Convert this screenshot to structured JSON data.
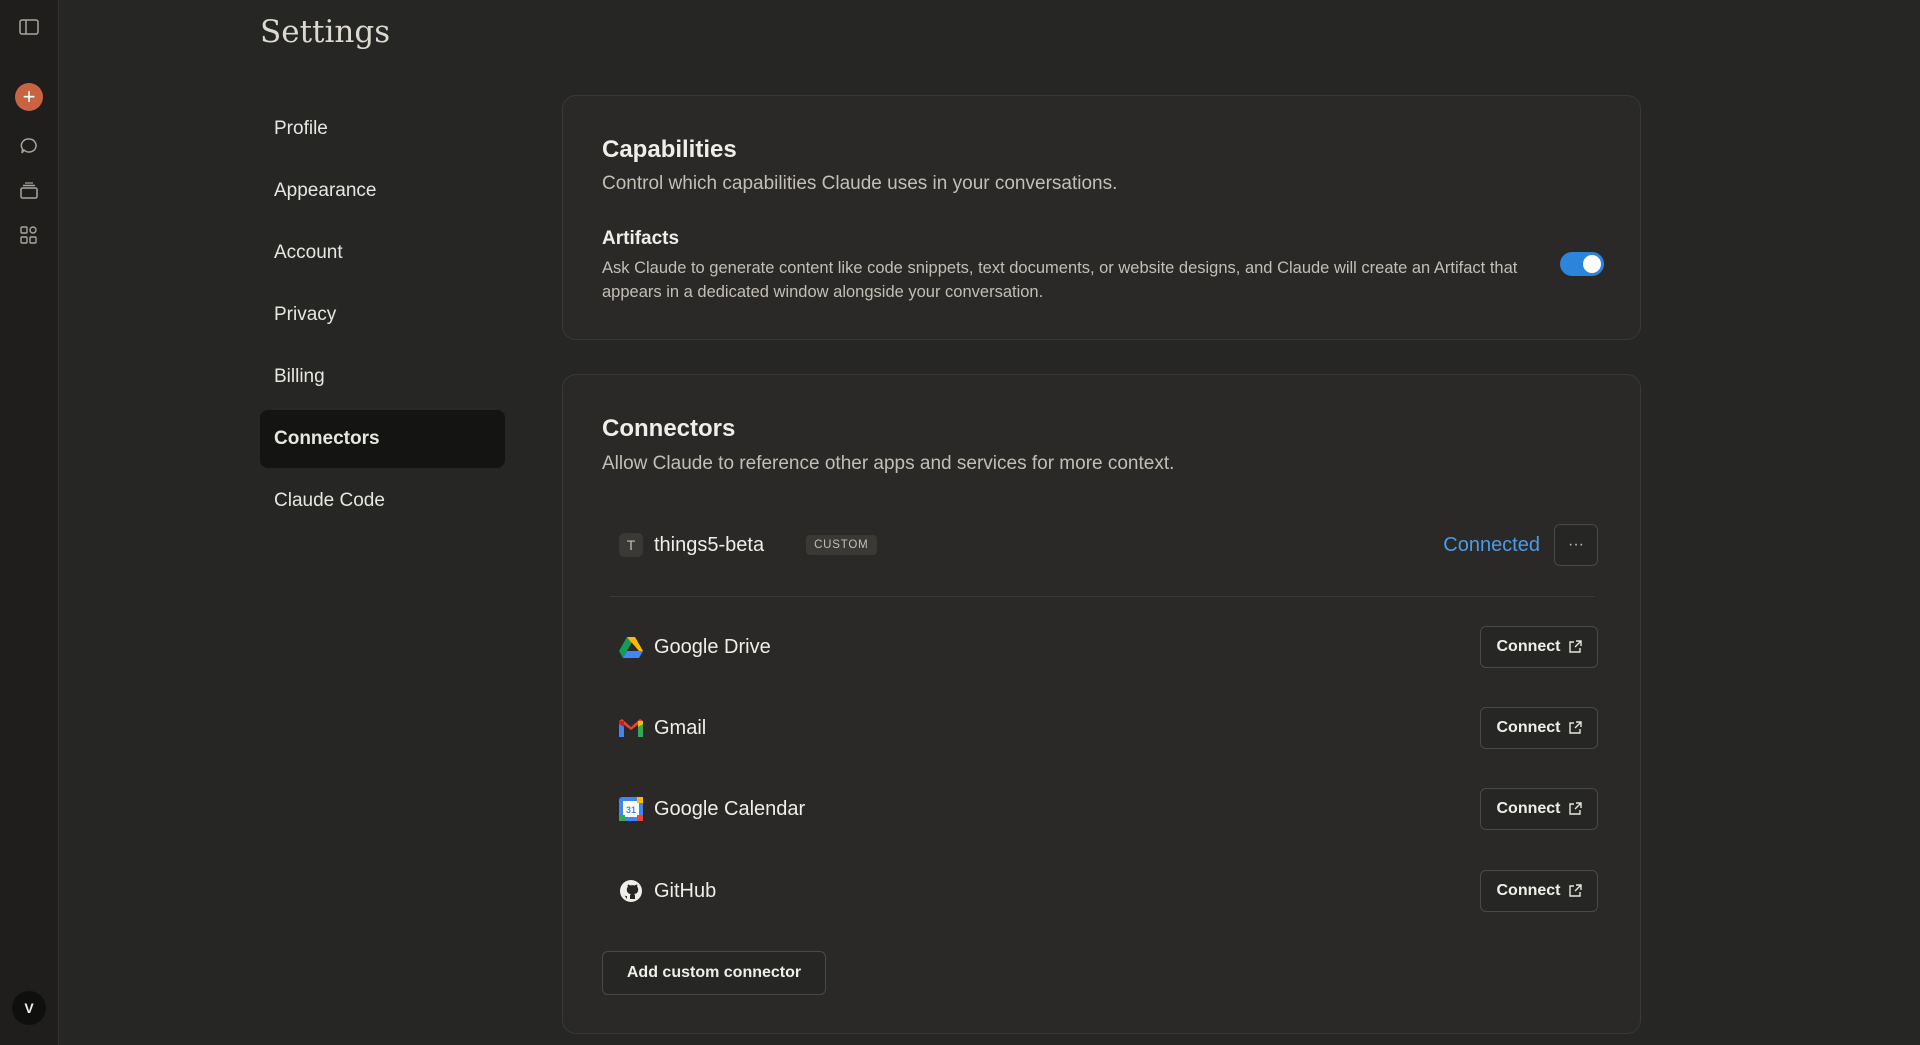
{
  "rail": {
    "icons": [
      "sidebar-toggle-icon",
      "new-chat-icon",
      "chats-icon",
      "projects-icon",
      "artifacts-icon"
    ],
    "accent": "#c96442",
    "avatar_initial": "V"
  },
  "page": {
    "title": "Settings"
  },
  "nav": {
    "items": [
      {
        "label": "Profile"
      },
      {
        "label": "Appearance"
      },
      {
        "label": "Account"
      },
      {
        "label": "Privacy"
      },
      {
        "label": "Billing"
      },
      {
        "label": "Connectors",
        "active": true
      },
      {
        "label": "Claude Code"
      }
    ]
  },
  "capabilities": {
    "title": "Capabilities",
    "subtitle": "Control which capabilities Claude uses in your conversations.",
    "artifacts": {
      "title": "Artifacts",
      "description": "Ask Claude to generate content like code snippets, text documents, or website designs, and Claude will create an Artifact that appears in a dedicated window alongside your conversation.",
      "enabled": true,
      "toggle_color": "#2c84db"
    }
  },
  "connectors": {
    "title": "Connectors",
    "subtitle": "Allow Claude to reference other apps and services for more context.",
    "custom": {
      "icon_letter": "T",
      "name": "things5-beta",
      "badge": "CUSTOM",
      "status": "Connected",
      "more_label": "···"
    },
    "items": [
      {
        "name": "Google Drive",
        "icon": "google-drive-icon",
        "button": "Connect"
      },
      {
        "name": "Gmail",
        "icon": "gmail-icon",
        "button": "Connect"
      },
      {
        "name": "Google Calendar",
        "icon": "google-calendar-icon",
        "button": "Connect"
      },
      {
        "name": "GitHub",
        "icon": "github-icon",
        "button": "Connect"
      }
    ],
    "add_label": "Add custom connector"
  }
}
